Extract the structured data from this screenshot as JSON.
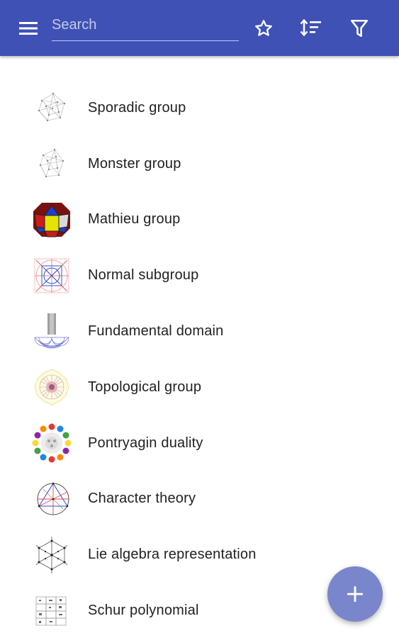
{
  "header": {
    "search_placeholder": "Search",
    "menu_icon": "menu-icon",
    "favorites_icon": "star-outline-icon",
    "sort_icon": "sort-icon",
    "filter_icon": "filter-icon",
    "background_color": "#3f51b5"
  },
  "list": {
    "items": [
      {
        "label": "Sporadic group",
        "icon": "sporadic-group-thumbnail-icon"
      },
      {
        "label": "Monster group",
        "icon": "monster-group-thumbnail-icon"
      },
      {
        "label": "Mathieu group",
        "icon": "mathieu-group-thumbnail-icon"
      },
      {
        "label": "Normal subgroup",
        "icon": "normal-subgroup-thumbnail-icon"
      },
      {
        "label": "Fundamental domain",
        "icon": "fundamental-domain-thumbnail-icon"
      },
      {
        "label": "Topological group",
        "icon": "topological-group-thumbnail-icon"
      },
      {
        "label": "Pontryagin duality",
        "icon": "pontryagin-duality-thumbnail-icon"
      },
      {
        "label": "Character theory",
        "icon": "character-theory-thumbnail-icon"
      },
      {
        "label": "Lie algebra representation",
        "icon": "lie-algebra-thumbnail-icon"
      },
      {
        "label": "Schur polynomial",
        "icon": "schur-polynomial-thumbnail-icon"
      }
    ]
  },
  "fab": {
    "icon": "plus-icon",
    "color": "#7986cb"
  }
}
